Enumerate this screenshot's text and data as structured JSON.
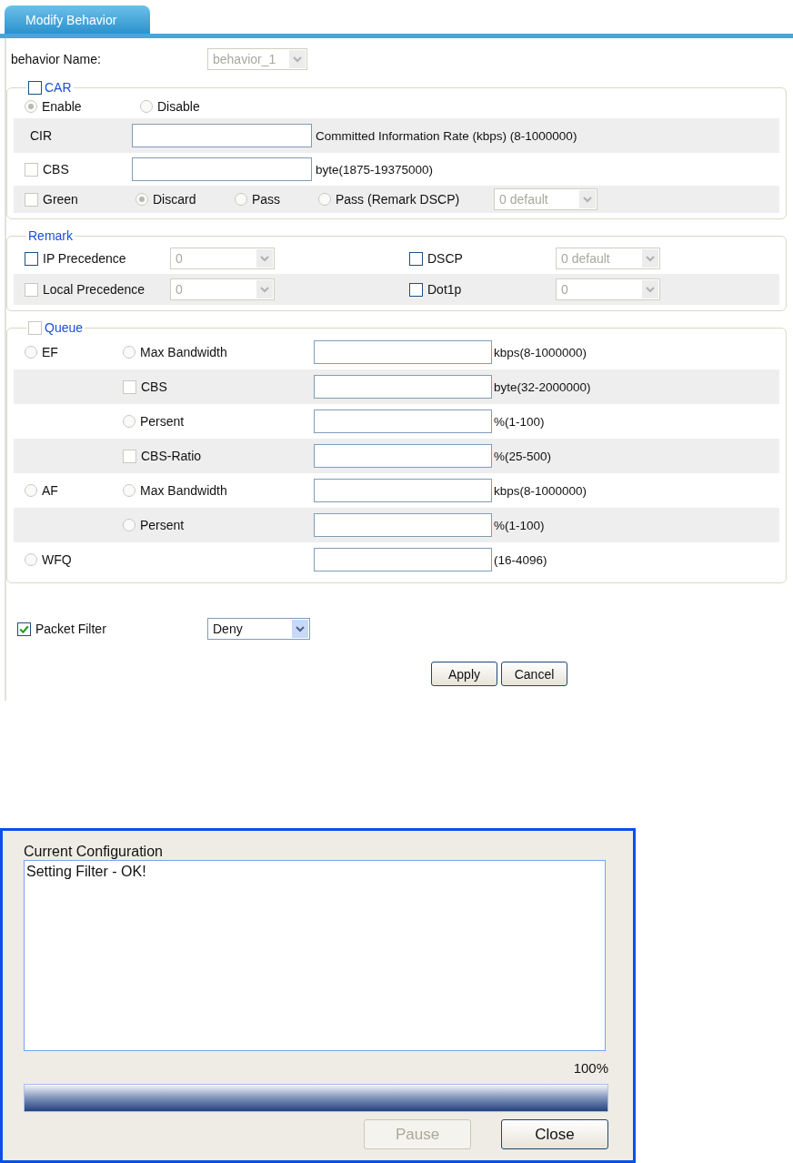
{
  "tab": {
    "label": "Modify Behavior",
    "selected": true
  },
  "behavior_name": {
    "label": "behavior Name:",
    "select": {
      "value": "behavior_1",
      "disabled": true
    }
  },
  "car": {
    "legend": "CAR",
    "checked": false,
    "disabled": false,
    "modes": [
      {
        "label": "Enable",
        "selected": true
      },
      {
        "label": "Disable",
        "selected": false
      }
    ],
    "cir": {
      "label": "CIR",
      "hint": "Committed Information Rate (kbps) (8-1000000)"
    },
    "cbs": {
      "label": "CBS",
      "checked": false,
      "disabled": true,
      "hint": "byte(1875-19375000)"
    },
    "green": {
      "label": "Green",
      "checked": false,
      "disabled": true,
      "actions": [
        {
          "label": "Discard",
          "selected": true
        },
        {
          "label": "Pass",
          "selected": false
        },
        {
          "label": "Pass (Remark DSCP)",
          "selected": false
        }
      ],
      "select": {
        "value": "0 default",
        "disabled": true
      }
    }
  },
  "remark": {
    "legend": "Remark",
    "items": [
      {
        "label": "IP Precedence",
        "checked": false,
        "disabled": false,
        "select": {
          "value": "0",
          "disabled": true
        }
      },
      {
        "label": "DSCP",
        "checked": false,
        "disabled": false,
        "select": {
          "value": "0 default",
          "disabled": true
        }
      },
      {
        "label": "Local Precedence",
        "checked": false,
        "disabled": true,
        "select": {
          "value": "0",
          "disabled": true
        }
      },
      {
        "label": "Dot1p",
        "checked": false,
        "disabled": false,
        "select": {
          "value": "0",
          "disabled": true
        }
      }
    ]
  },
  "queue": {
    "legend": "Queue",
    "checked": false,
    "disabled": true,
    "rows": [
      {
        "mode": {
          "label": "EF",
          "selected": false
        },
        "option": {
          "kind": "radio",
          "label": "Max Bandwidth",
          "selected": false
        },
        "hint": "kbps(8-1000000)"
      },
      {
        "option": {
          "kind": "checkbox",
          "label": "CBS",
          "checked": false,
          "disabled": true
        },
        "hint": "byte(32-2000000)"
      },
      {
        "option": {
          "kind": "radio",
          "label": "Persent",
          "selected": false
        },
        "hint": "%(1-100)"
      },
      {
        "option": {
          "kind": "checkbox",
          "label": "CBS-Ratio",
          "checked": false,
          "disabled": true
        },
        "hint": "%(25-500)"
      },
      {
        "mode": {
          "label": "AF",
          "selected": false
        },
        "option": {
          "kind": "radio",
          "label": "Max Bandwidth",
          "selected": false
        },
        "hint": "kbps(8-1000000)"
      },
      {
        "option": {
          "kind": "radio",
          "label": "Persent",
          "selected": false
        },
        "hint": "%(1-100)"
      },
      {
        "mode": {
          "label": "WFQ",
          "selected": false
        },
        "hint": "(16-4096)"
      }
    ]
  },
  "packet_filter": {
    "label": "Packet Filter",
    "checked": true,
    "disabled": false,
    "select": {
      "value": "Deny",
      "disabled": false
    }
  },
  "buttons": [
    {
      "label": "Apply"
    },
    {
      "label": "Cancel"
    }
  ],
  "dialog": {
    "title": "Current Configuration",
    "log": "Setting Filter - OK!",
    "percent": "100%",
    "progress": {
      "level": 1
    },
    "buttons": [
      {
        "label": "Pause",
        "disabled": true
      },
      {
        "label": "Close",
        "disabled": false
      }
    ]
  }
}
